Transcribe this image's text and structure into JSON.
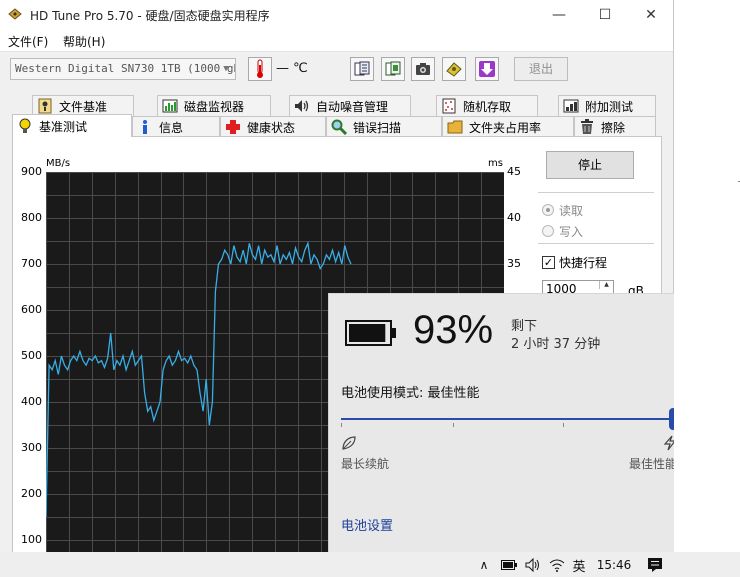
{
  "window": {
    "title": "HD Tune Pro 5.70 - 硬盘/固态硬盘实用程序",
    "minimize_glyph": "—",
    "maximize_glyph": "☐",
    "close_glyph": "✕"
  },
  "menu": {
    "file": "文件(F)",
    "help": "帮助(H)"
  },
  "toolbar": {
    "drive": "Western Digital SN730 1TB (1000 gB)",
    "temperature": "— ℃",
    "exit_label": "退出",
    "icons": [
      "thermometer-icon",
      "copy-info-icon",
      "copy-screen-icon",
      "camera-icon",
      "health-icon",
      "download-icon"
    ]
  },
  "tabs": {
    "row1": [
      "文件基准",
      "磁盘监视器",
      "自动噪音管理",
      "随机存取",
      "附加测试"
    ],
    "row2": [
      "基准测试",
      "信息",
      "健康状态",
      "错误扫描",
      "文件夹占用率",
      "擦除"
    ],
    "active": "基准测试"
  },
  "chart_data": {
    "type": "line",
    "left_unit": "MB/s",
    "right_unit": "ms",
    "left_ticks": [
      "900",
      "800",
      "700",
      "600",
      "500",
      "400",
      "300",
      "200",
      "100"
    ],
    "right_ticks": [
      "45",
      "40",
      "35"
    ],
    "ylim": [
      0,
      900
    ],
    "series": [
      {
        "values": [
          150,
          480,
          470,
          490,
          460,
          500,
          480,
          470,
          490,
          500,
          490,
          510,
          490,
          480,
          495,
          490,
          500,
          485,
          490,
          475,
          495,
          550,
          470,
          490,
          480,
          500,
          470,
          490,
          510,
          480,
          490,
          500,
          420,
          380,
          390,
          360,
          380,
          400,
          470,
          490,
          500,
          480,
          490,
          510,
          490,
          495,
          485,
          500,
          480,
          470,
          420,
          380,
          450,
          350,
          400,
          640,
          700,
          710,
          730,
          720,
          700,
          740,
          715,
          705,
          730,
          700,
          745,
          720,
          710,
          740,
          700,
          730,
          715,
          720,
          705,
          740,
          700,
          720,
          710,
          725,
          700,
          735,
          715,
          705,
          730,
          745,
          700,
          720,
          710,
          690,
          700,
          720,
          710,
          730,
          705,
          725,
          700,
          740,
          715,
          700
        ]
      }
    ]
  },
  "controls": {
    "stop_label": "停止",
    "read_label": "读取",
    "write_label": "写入",
    "quick_label": "快捷行程",
    "quick_checked": true,
    "quick_check_glyph": "✓",
    "size_value": "1000",
    "size_unit": "gB"
  },
  "battery": {
    "percent": "93%",
    "level": 0.93,
    "remaining_label": "剩下",
    "remaining_time": "2 小时 37 分钟",
    "mode_label": "电池使用模式: 最佳性能",
    "slider_min_label": "最长续航",
    "slider_max_label": "最佳性能",
    "slider_position": 1.0,
    "settings_link": "电池设置"
  },
  "taskbar": {
    "chevron": "∧",
    "ime": "英",
    "time": "15:46"
  }
}
